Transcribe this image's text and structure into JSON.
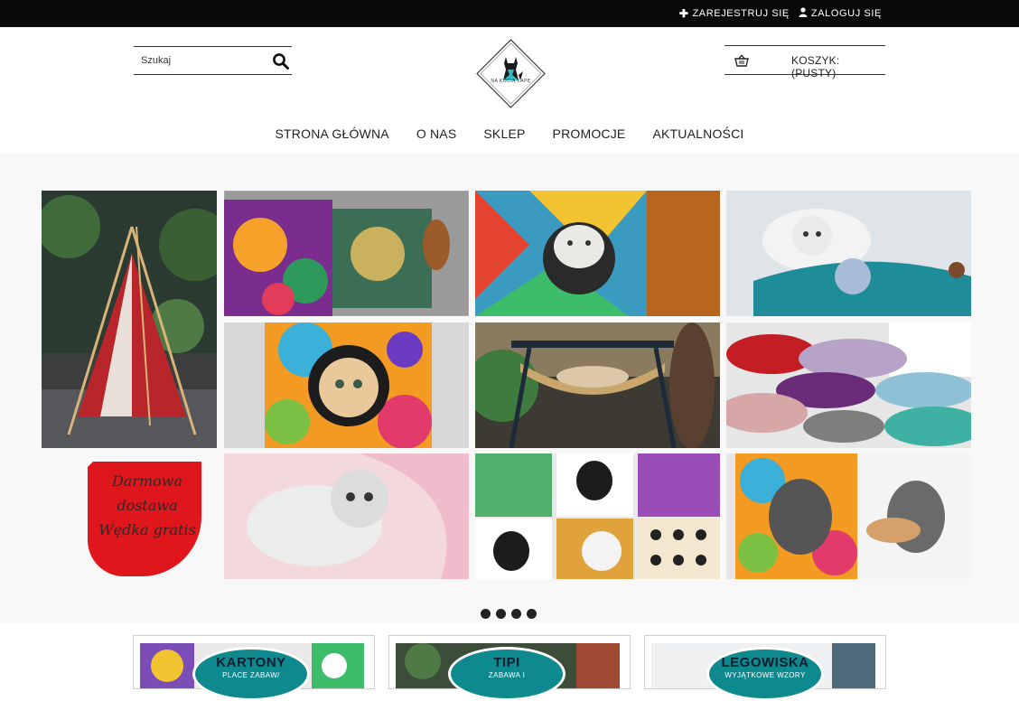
{
  "topbar": {
    "register_label": "ZAREJESTRUJ SIĘ",
    "login_label": "ZALOGUJ SIĘ",
    "register_icon": "plus-icon",
    "login_icon": "user-icon"
  },
  "header": {
    "search_placeholder": "Szukaj",
    "logo_text": "NA KOCIĄ ŁAPĘ",
    "cart_label": "KOSZYK: (PUSTY)"
  },
  "nav": {
    "items": [
      "STRONA GŁÓWNA",
      "O NAS",
      "SKLEP",
      "PROMOCJE",
      "AKTUALNOŚCI"
    ]
  },
  "slider": {
    "promo_line1": "Darmowa",
    "promo_line2": "dostawa",
    "promo_line3": "Wędka gratis",
    "slide_count": 4,
    "active_slide": 2
  },
  "categories": [
    {
      "title": "KARTONY",
      "subtitle": "PLACE ZABAW/"
    },
    {
      "title": "TIPI",
      "subtitle": "ZABAWA I"
    },
    {
      "title": "LEGOWISKA",
      "subtitle": "WYJĄTKOWE WZORY"
    }
  ],
  "colors": {
    "topbar": "#0a0a0a",
    "accent_teal": "#0e8a8e",
    "promo_red": "#e0161d"
  }
}
